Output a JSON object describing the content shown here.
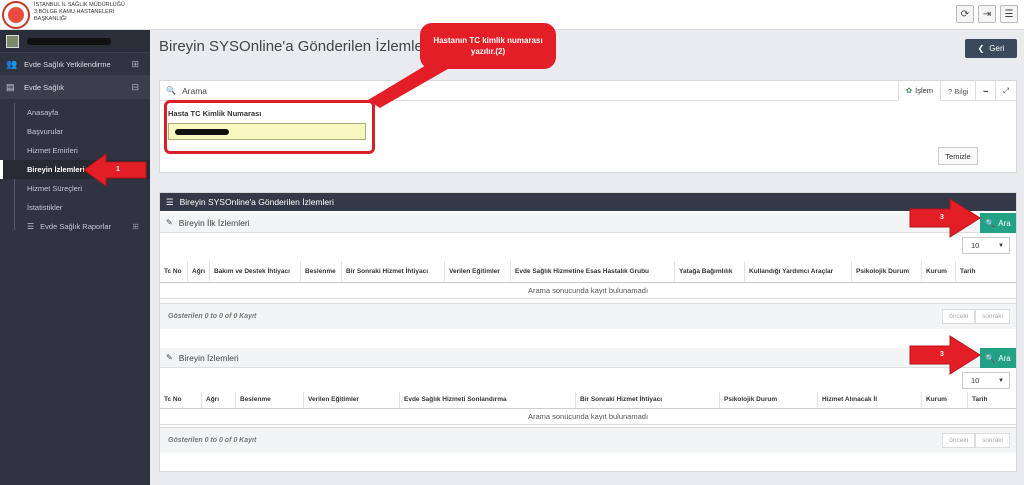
{
  "org": {
    "line1": "İSTANBUL İL SAĞLIK MÜDÜRLÜĞÜ",
    "line2": "3.BÖLGE KAMU HASTANELERİ",
    "line3": "BAŞKANLIĞI"
  },
  "sidebar": {
    "menu1": "Evde Sağlık Yetkilendirme",
    "menu2": "Evde Sağlık",
    "items": [
      "Anasayfa",
      "Başvurular",
      "Hizmet Emirleri",
      "Bireyin İzlemleri",
      "Hizmet Süreçleri",
      "İstatistikler",
      "Evde Sağlık Raporlar"
    ]
  },
  "page": {
    "title": "Bireyin SYSOnline'a Gönderilen İzlemleri",
    "back_label": "Geri"
  },
  "search_box": {
    "title": "Arama",
    "tab_islem": "İşlem",
    "tab_bilgi": "Bilgi",
    "field_label": "Hasta TC Kimlik Numarası",
    "clear_label": "Temizle"
  },
  "results": {
    "title": "Bireyin SYSOnline'a Gönderilen İzlemleri",
    "search_label": "Ara",
    "page_size": "10",
    "empty_text": "Arama sonucunda kayıt bulunamadı",
    "footer_text": "Gösterilen 0 to 0 of 0 Kayıt",
    "prev": "önceki",
    "next": "sonraki",
    "first": {
      "title": "Bireyin İlk İzlemleri",
      "columns": [
        "Tc No",
        "Ağrı",
        "Bakım ve Destek İhtiyacı",
        "Beslenme",
        "Bir Sonraki Hizmet İhtiyacı",
        "Verilen Eğitimler",
        "Evde Sağlık Hizmetine Esas Hastalık Grubu",
        "Yatağa Bağımlılık",
        "Kullandığı Yardımcı Araçlar",
        "Psikolojik Durum",
        "Kurum",
        "Tarih"
      ]
    },
    "second": {
      "title": "Bireyin İzlemleri",
      "columns": [
        "Tc No",
        "Ağrı",
        "Beslenme",
        "Verilen Eğitimler",
        "Evde Sağlık Hizmeti Sonlandırma",
        "Bir Sonraki Hizmet İhtiyacı",
        "Psikolojik Durum",
        "Hizmet Alınacak İl",
        "Kurum",
        "Tarih"
      ]
    }
  },
  "annotations": {
    "callout": "Hastanın TC kimlik numarası yazılır.(2)",
    "step1": "1",
    "step3": "3"
  },
  "colors": {
    "sidebar_bg": "#2f3440",
    "accent_red": "#e41e26",
    "search_green": "#23a184",
    "input_yellow": "#f7f8c0"
  }
}
